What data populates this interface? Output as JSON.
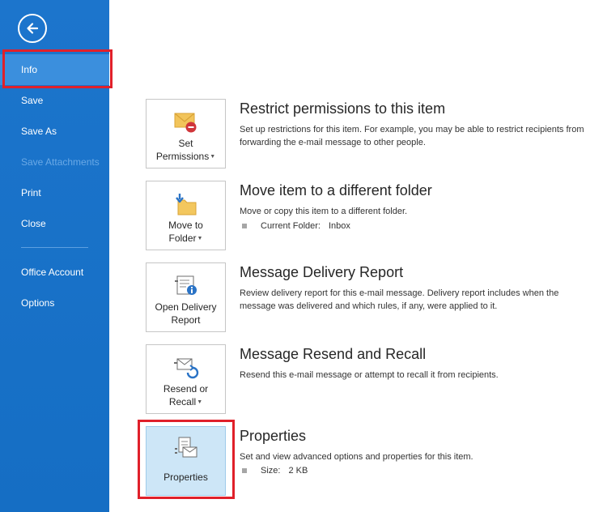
{
  "sidebar": {
    "items": [
      {
        "label": "Info",
        "state": "active"
      },
      {
        "label": "Save",
        "state": "normal"
      },
      {
        "label": "Save As",
        "state": "normal"
      },
      {
        "label": "Save Attachments",
        "state": "disabled"
      },
      {
        "label": "Print",
        "state": "normal"
      },
      {
        "label": "Close",
        "state": "normal"
      },
      {
        "label": "Office Account",
        "state": "normal"
      },
      {
        "label": "Options",
        "state": "normal"
      }
    ],
    "back_icon": "back-arrow-icon",
    "background_color": "#1a73c9"
  },
  "sections": [
    {
      "tile_line1": "Set",
      "tile_line2": "Permissions",
      "has_dropdown": true,
      "icon": "envelope-restrict-icon",
      "title": "Restrict permissions to this item",
      "description": "Set up restrictions for this item. For example, you may be able to restrict recipients from forwarding the e-mail message to other people."
    },
    {
      "tile_line1": "Move to",
      "tile_line2": "Folder",
      "has_dropdown": true,
      "icon": "move-to-folder-icon",
      "title": "Move item to a different folder",
      "description": "Move or copy this item to a different folder.",
      "detail_label": "Current Folder:",
      "detail_value": "Inbox"
    },
    {
      "tile_line1": "Open Delivery",
      "tile_line2": "Report",
      "has_dropdown": false,
      "icon": "delivery-report-icon",
      "title": "Message Delivery Report",
      "description": "Review delivery report for this e-mail message. Delivery report includes when the message was delivered and which rules, if any, were applied to it."
    },
    {
      "tile_line1": "Resend or",
      "tile_line2": "Recall",
      "has_dropdown": true,
      "icon": "resend-recall-icon",
      "title": "Message Resend and Recall",
      "description": "Resend this e-mail message or attempt to recall it from recipients."
    },
    {
      "tile_line1": "Properties",
      "tile_line2": "",
      "has_dropdown": false,
      "icon": "properties-icon",
      "title": "Properties",
      "description": "Set and view advanced options and properties for this item.",
      "detail_label": "Size:",
      "detail_value": "2 KB"
    }
  ],
  "colors": {
    "accent": "#1a73c9",
    "highlight": "#e0202a",
    "selected_tile": "#cde6f7"
  }
}
